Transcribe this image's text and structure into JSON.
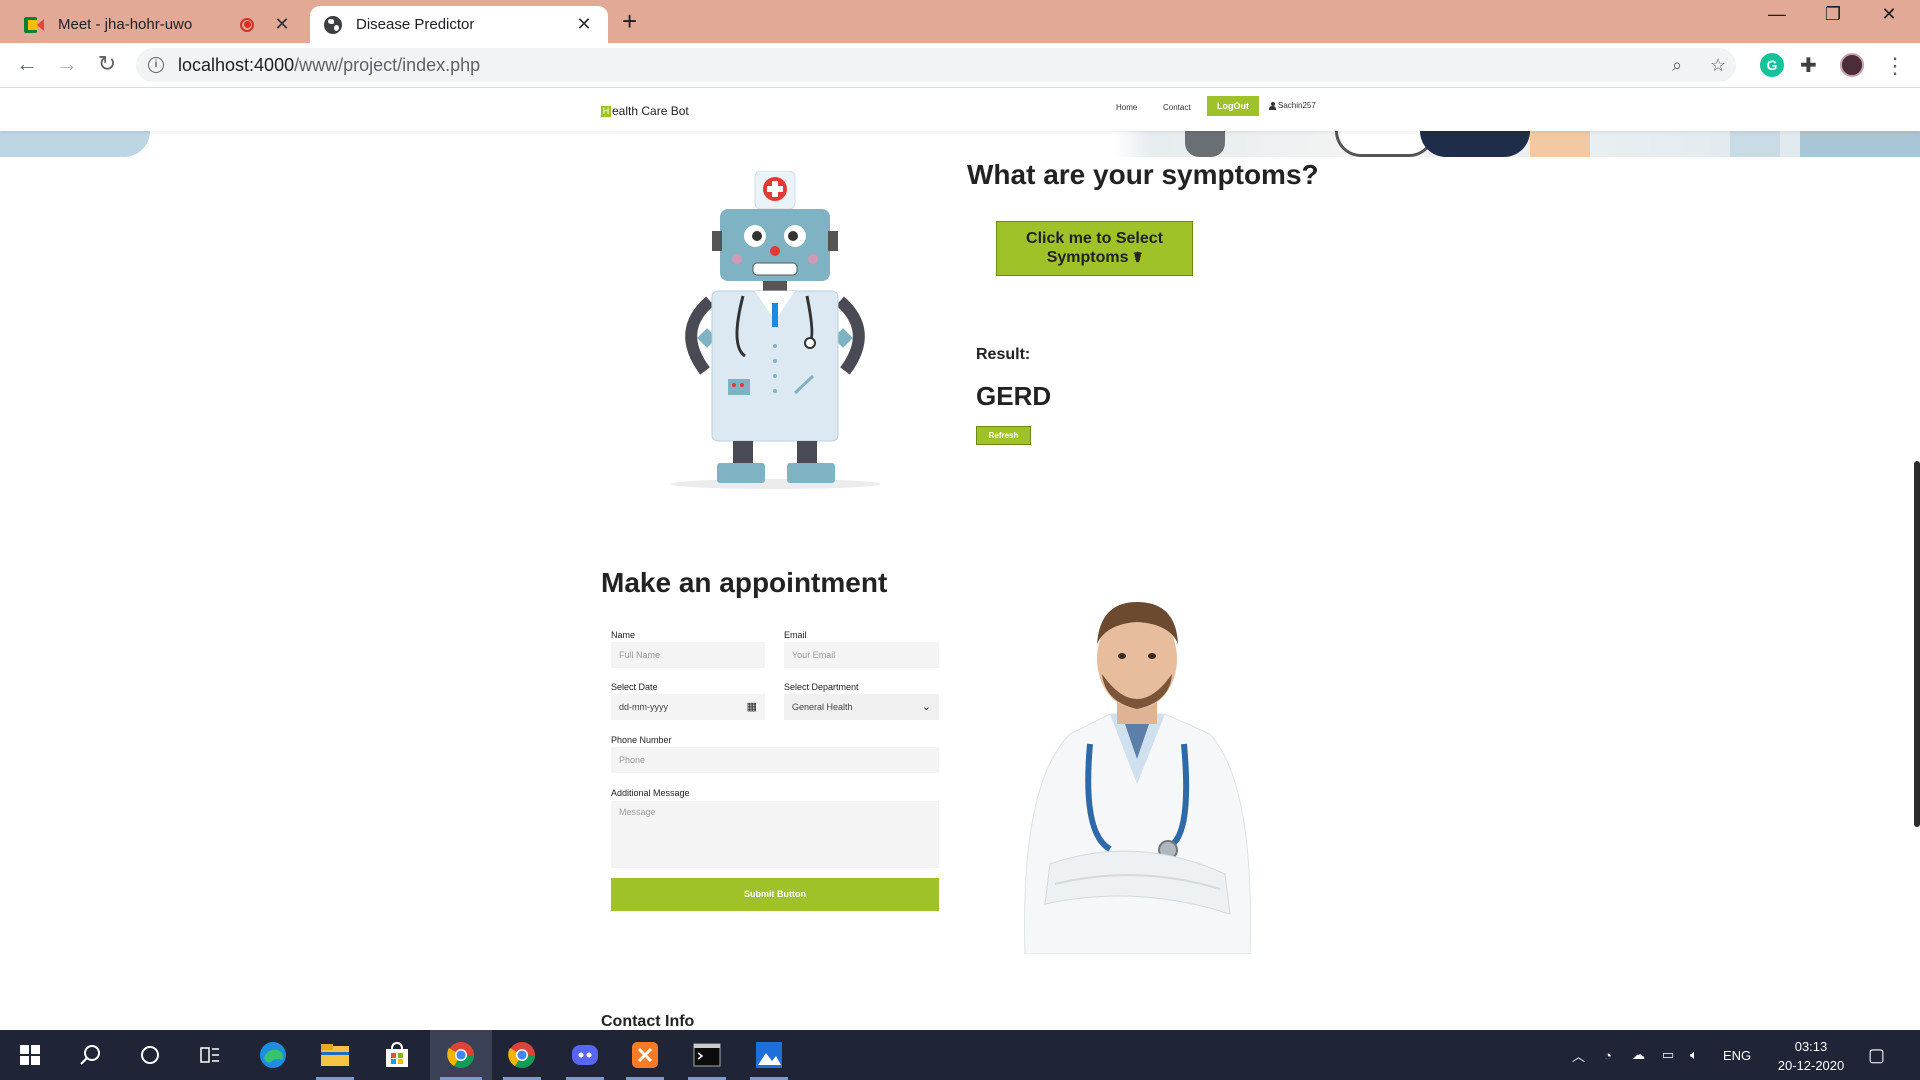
{
  "browser": {
    "tabs": [
      {
        "title": "Meet - jha-hohr-uwo",
        "recording": true,
        "icon": "google-meet-icon"
      },
      {
        "title": "Disease Predictor",
        "icon": "globe-icon"
      }
    ],
    "url_host": "localhost:4000",
    "url_path": "/www/project/index.php"
  },
  "site": {
    "brand_initial": "H",
    "brand_rest": "ealth Care Bot",
    "nav": {
      "home": "Home",
      "contact": "Contact",
      "logout": "LogOut",
      "user": "Sachin257"
    },
    "accent_color": "#9fc229"
  },
  "predictor": {
    "title": "What are your symptoms?",
    "select_button": "Click me to Select Symptoms",
    "select_button_icon": "stethoscope-icon",
    "result_label": "Result:",
    "result_value": "GERD",
    "refresh_button": "Refresh"
  },
  "appointment": {
    "title": "Make an appointment",
    "name_label": "Name",
    "name_placeholder": "Full Name",
    "email_label": "Email",
    "email_placeholder": "Your Email",
    "date_label": "Select Date",
    "date_placeholder": "dd-mm-yyyy",
    "department_label": "Select Department",
    "department_value": "General Health",
    "phone_label": "Phone Number",
    "phone_placeholder": "Phone",
    "message_label": "Additional Message",
    "message_placeholder": "Message",
    "submit": "Submit Button"
  },
  "contact": {
    "title": "Contact Info"
  },
  "taskbar": {
    "apps": [
      "windows-start-icon",
      "search-icon",
      "cortana-icon",
      "task-view-icon",
      "edge-icon",
      "file-explorer-icon",
      "store-icon",
      "chrome-icon",
      "chrome-icon",
      "discord-icon",
      "xampp-icon",
      "terminal-icon",
      "photos-icon"
    ],
    "language": "ENG",
    "time": "03:13",
    "date": "20-12-2020"
  }
}
